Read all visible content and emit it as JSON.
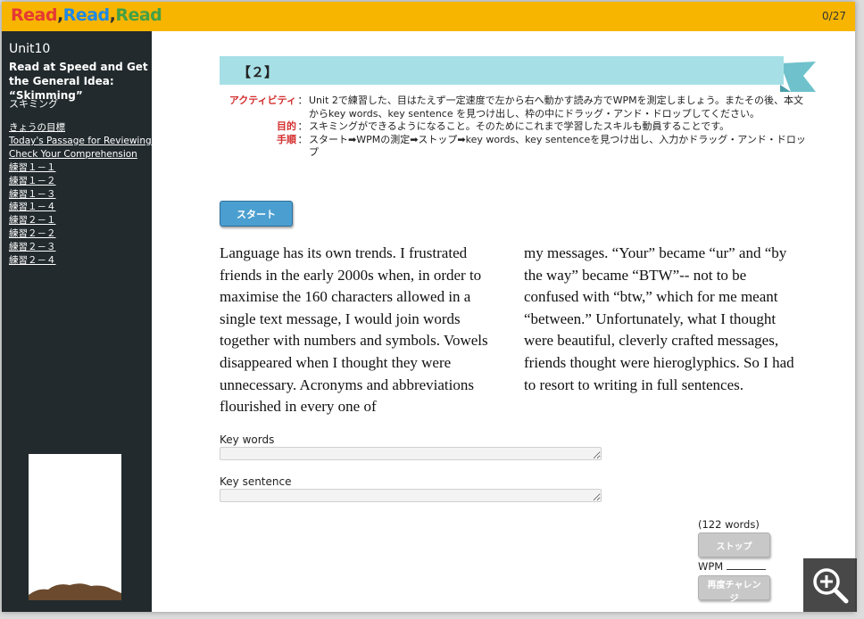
{
  "header": {
    "logo": [
      "Read",
      ",",
      "Read",
      ",",
      "Read"
    ],
    "counter": "0/27"
  },
  "sidebar": {
    "unit": "Unit10",
    "title": "Read at Speed and Get the General Idea: “Skimming”",
    "subtitle": "スキミング",
    "items": [
      "きょうの目標",
      "Today's Passage for Reviewing",
      "Check Your Comprehension",
      "練習１－１",
      "練習１－２",
      "練習１－３",
      "練習１－４",
      "練習２－１",
      "練習２－２",
      "練習２－３",
      "練習２－４"
    ]
  },
  "section": {
    "label": "【２】"
  },
  "instructions": [
    {
      "label": "アクティビティ",
      "text": "Unit 2で練習した、目はたえず一定速度で左から右へ動かす読み方でWPMを測定しましょう。またその後、本文からkey words、key sentence を見つけ出し、枠の中にドラッグ・アンド・ドロップしてください。"
    },
    {
      "label": "目的",
      "text": "スキミングができるようになること。そのためにこれまで学習したスキルも動員することです。"
    },
    {
      "label": "手順",
      "text": "スタート➡WPMの測定➡ストップ➡key words、key sentenceを見つけ出し、入力かドラッグ・アンド・ドロップ"
    }
  ],
  "start_button": "スタート",
  "passage": {
    "left": [
      "Language has its own trends. I frustrated",
      "friends in the early 2000s when, in order to",
      "maximise the 160 characters allowed in a",
      "single text message, I would join words",
      "together with numbers and symbols. Vowels",
      "disappeared when I thought they were",
      "unnecessary. Acronyms and abbreviations",
      "flourished in every one of"
    ],
    "right": [
      "my messages. “Your” became “ur” and “by",
      "the way” became “BTW”-- not to be",
      "confused with “btw,” which for me meant",
      "“between.” Unfortunately, what I thought",
      "were beautiful, cleverly crafted messages,",
      "friends thought were hieroglyphics. So I had",
      "to resort to writing in full sentences."
    ]
  },
  "key_words": {
    "label": "Key words",
    "value": ""
  },
  "key_sentence": {
    "label": "Key sentence",
    "value": ""
  },
  "word_count": "(122 words)",
  "stop_button": "ストップ",
  "wpm_label": "WPM",
  "retry_button": "再度チャレンジ",
  "colors": {
    "topbar": "#f7b500",
    "sidebar": "#222a2d",
    "ribbon": "#a6e0e6",
    "label_red": "#d32f2f",
    "start_blue": "#4b9fd0"
  }
}
